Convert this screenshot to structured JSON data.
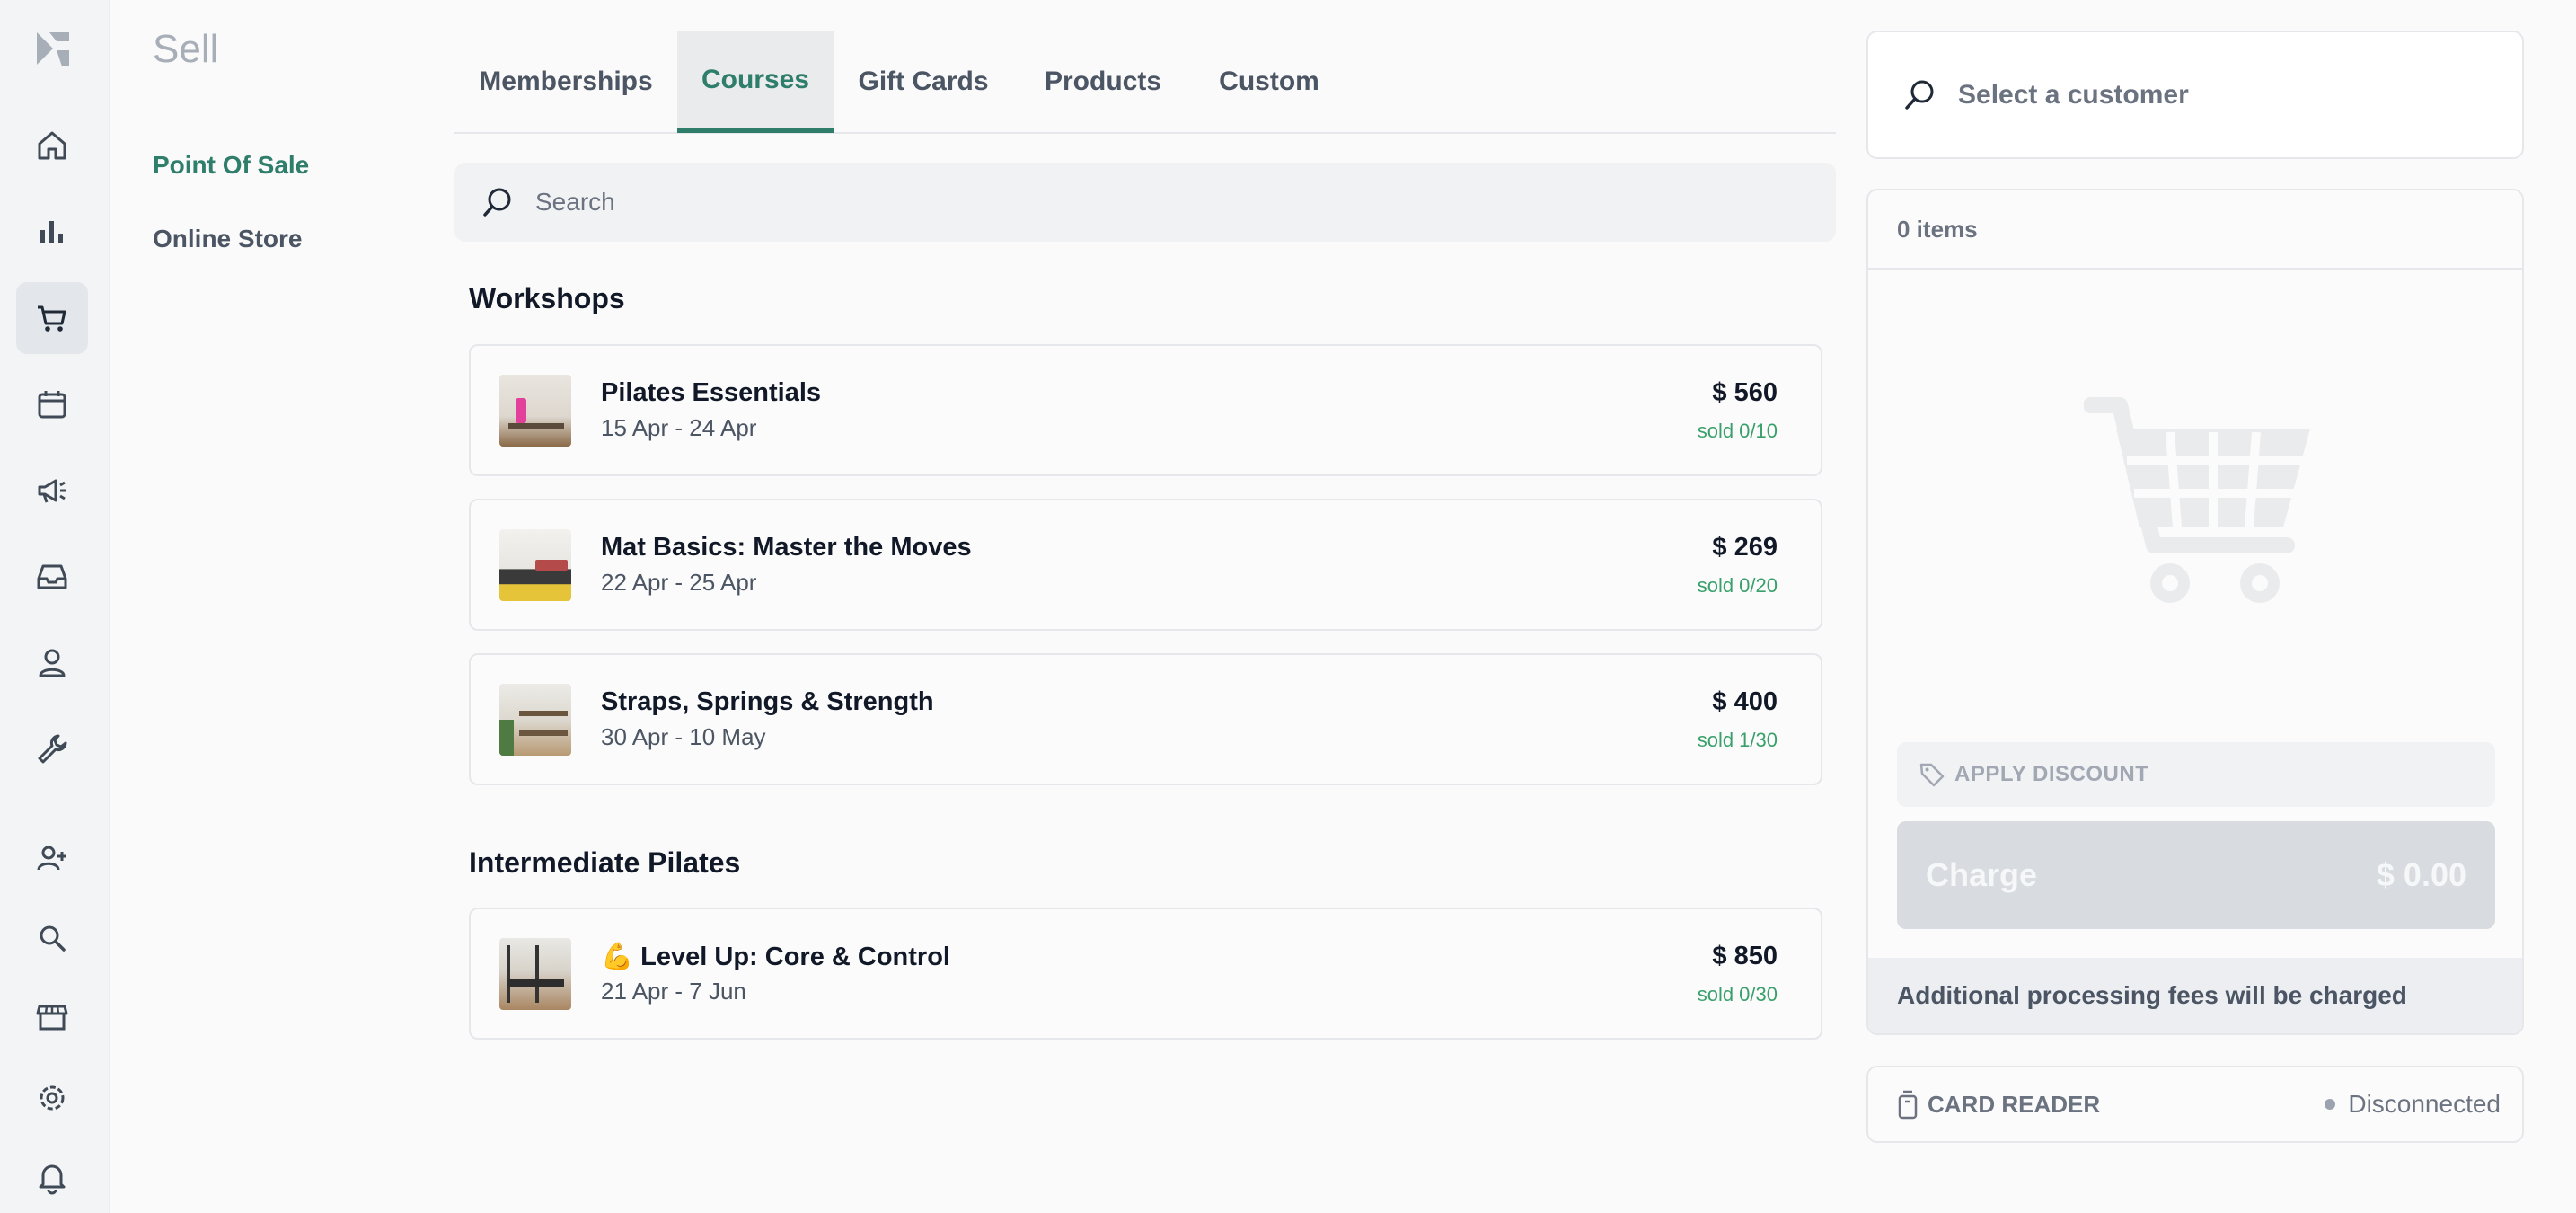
{
  "app": {
    "section_title": "Sell",
    "secondary_nav": [
      {
        "label": "Point Of Sale",
        "active": true
      },
      {
        "label": "Online Store",
        "active": false
      }
    ]
  },
  "rail": {
    "items": [
      "logo-icon",
      "home-icon",
      "bar-chart-icon",
      "shopping-cart-icon",
      "calendar-icon",
      "megaphone-icon",
      "inbox-icon",
      "user-icon",
      "wrench-icon",
      "add-user-icon",
      "search-icon",
      "store-icon",
      "gear-icon",
      "bell-icon"
    ],
    "active": "shopping-cart-icon"
  },
  "tabs": [
    {
      "label": "Memberships",
      "active": false
    },
    {
      "label": "Courses",
      "active": true
    },
    {
      "label": "Gift Cards",
      "active": false
    },
    {
      "label": "Products",
      "active": false
    },
    {
      "label": "Custom",
      "active": false
    }
  ],
  "search": {
    "placeholder": "Search"
  },
  "groups": [
    {
      "title": "Workshops",
      "items": [
        {
          "name": "Pilates Essentials",
          "dates": "15 Apr - 24 Apr",
          "price": "$ 560",
          "sold": "sold 0/10"
        },
        {
          "name": "Mat Basics: Master the Moves",
          "dates": "22 Apr - 25 Apr",
          "price": "$ 269",
          "sold": "sold 0/20"
        },
        {
          "name": "Straps, Springs & Strength",
          "dates": "30 Apr - 10 May",
          "price": "$ 400",
          "sold": "sold 1/30"
        }
      ]
    },
    {
      "title": "Intermediate Pilates",
      "items": [
        {
          "name": "💪 Level Up: Core & Control",
          "dates": "21 Apr - 7 Jun",
          "price": "$ 850",
          "sold": "sold 0/30"
        }
      ]
    }
  ],
  "customer": {
    "placeholder": "Select a customer"
  },
  "cart": {
    "items_count": "0 items",
    "apply_discount": "APPLY DISCOUNT",
    "charge_label": "Charge",
    "charge_amount": "$ 0.00",
    "fees_note": "Additional processing fees will be charged"
  },
  "card_reader": {
    "label": "CARD READER",
    "status": "Disconnected"
  },
  "colors": {
    "accent": "#2f7d6b",
    "sold": "#3aa06b",
    "muted": "#a7aeb8"
  }
}
